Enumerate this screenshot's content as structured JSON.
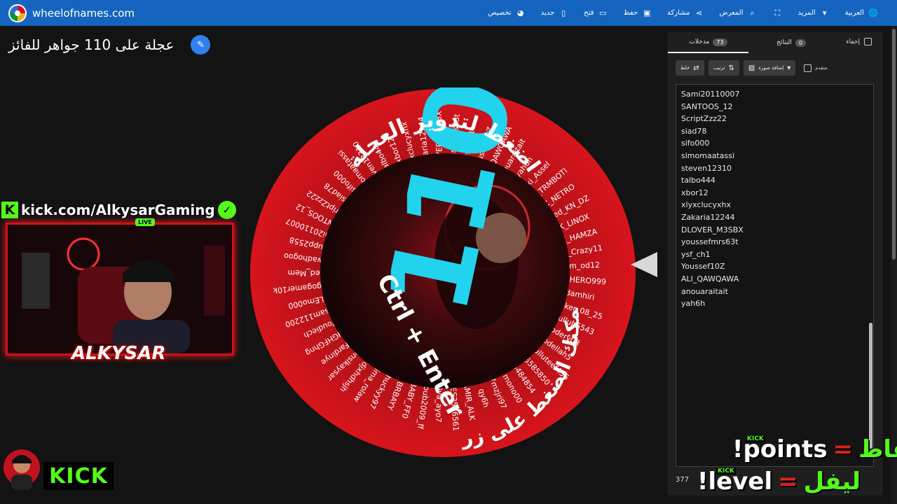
{
  "topbar": {
    "site_name": "wheelofnames.com",
    "nav": [
      {
        "label": "العربية",
        "icon": "globe-icon"
      },
      {
        "label": "المزيد",
        "icon": "caret-down-icon"
      },
      {
        "label": "",
        "icon": "fullscreen-icon"
      },
      {
        "label": "المعرض",
        "icon": "search-icon"
      },
      {
        "label": "مشاركة",
        "icon": "share-icon"
      },
      {
        "label": "حفظ",
        "icon": "save-icon"
      },
      {
        "label": "فتح",
        "icon": "folder-icon"
      },
      {
        "label": "جديد",
        "icon": "new-file-icon"
      },
      {
        "label": "تخصيص",
        "icon": "palette-icon"
      }
    ]
  },
  "page_title": "عجلة على 110 جواهر للفائز",
  "wheel": {
    "center_number": "110",
    "instruction_top": "اضغط لتدوير العجلة",
    "instruction_bottom": "أو يمكنك الضغط على زر",
    "shortcut": "Ctrl + Enter",
    "entries_visible": [
      "Sami20110007",
      "SANTOOS_12",
      "ScriptZzz22",
      "siad78",
      "sifo000",
      "simomaatassi",
      "steven12310",
      "talbo444",
      "xbor12",
      "xlyxclucyxhx",
      "Zakaria12244",
      "DLOVER_M3SBX",
      "youssefmrs63t",
      "ysf_ch1",
      "Youssef10Z",
      "ALI_QAWQAWA",
      "anouaraitait",
      "yah6h",
      "Alki_Assel",
      "ALK_TRMBOTI",
      "ALK_NETRO",
      "Hamed_KN_DZ",
      "ALK_LINOX",
      "ALK_HAMZA",
      "ALK_Crazy11",
      "Ahm_od12",
      "ANDHERO999",
      "adamhiri",
      "abooker_08_25",
      "abdulluh5543",
      "abderv03",
      "abdellah5",
      "abdulluteef456",
      "55585850",
      "5484854",
      "7mono00",
      "7mzjri97",
      "qy6h",
      "AMIR_ALK",
      "ANES2556561",
      "Aya_ayo7",
      "Ayoub2009_ff",
      "BABY_FF0",
      "BRBAYY",
      "chuckyy97",
      "Dima_rolaw",
      "djdjxhdhsjh",
      "fonslkaysar",
      "Fardinye",
      "FHGHFGhng",
      "foudiech",
      "hossam112200",
      "ISLEmo000",
      "mrzagogamer10k",
      "Red_Mem",
      "jowadhogoo",
      "loupp2558"
    ],
    "colors": {
      "primary": "#c8141c",
      "dark": "#3a0508",
      "text_accent": "#22d3ee"
    }
  },
  "panel": {
    "hide_label": "إخفاء",
    "tabs": [
      {
        "label": "مدخلات",
        "count": "73",
        "active": true
      },
      {
        "label": "النتائج",
        "count": "0",
        "active": false
      }
    ],
    "toolbar": {
      "shuffle": "خلط",
      "sort": "ترتيب",
      "add_image": "إضافة صورة",
      "advanced": "متقدم"
    },
    "entries": [
      "Sami20110007",
      "SANTOOS_12",
      "ScriptZzz22",
      "siad78",
      "sifo000",
      "simomaatassi",
      "steven12310",
      "talbo444",
      "xbor12",
      "xlyxclucyxhx",
      "Zakaria12244",
      "DLOVER_M3SBX",
      "youssefmrs63t",
      "ysf_ch1",
      "Youssef10Z",
      "ALI_QAWQAWA",
      "anouaraitait",
      "yah6h"
    ],
    "footer_version": "377"
  },
  "overlay": {
    "kick_url": "kick.com/AlkysarGaming",
    "live": "LIVE",
    "streamer_name": "ALKYSAR",
    "kick_word": "KICK",
    "cmd_points_ar": "نقاط",
    "cmd_points_en": "!points",
    "cmd_level_ar": "ليفل",
    "cmd_level_en": "!level",
    "equals": "=",
    "brand_color": "#53fc18"
  }
}
